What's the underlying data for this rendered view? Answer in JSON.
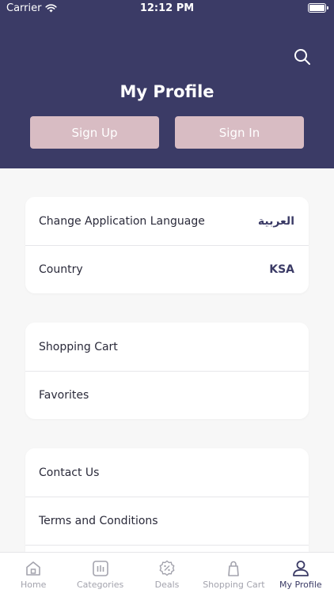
{
  "status_bar": {
    "carrier": "Carrier",
    "time": "12:12 PM"
  },
  "header": {
    "title": "My Profile",
    "sign_up_label": "Sign Up",
    "sign_in_label": "Sign In",
    "search_icon": "search-icon"
  },
  "settings_card": {
    "language": {
      "label": "Change Application Language",
      "value": "العربية"
    },
    "country": {
      "label": "Country",
      "value": "KSA"
    }
  },
  "shopping_card": {
    "cart_label": "Shopping Cart",
    "favorites_label": "Favorites"
  },
  "info_card": {
    "contact_label": "Contact Us",
    "terms_label": "Terms and Conditions"
  },
  "tabbar": {
    "home": "Home",
    "categories": "Categories",
    "deals": "Deals",
    "cart": "Shopping Cart",
    "profile": "My Profile"
  },
  "colors": {
    "header_bg": "#3b3b66",
    "auth_button": "#d8bcc3",
    "tab_inactive": "#a3a3ad",
    "tab_active": "#3b3b66"
  }
}
